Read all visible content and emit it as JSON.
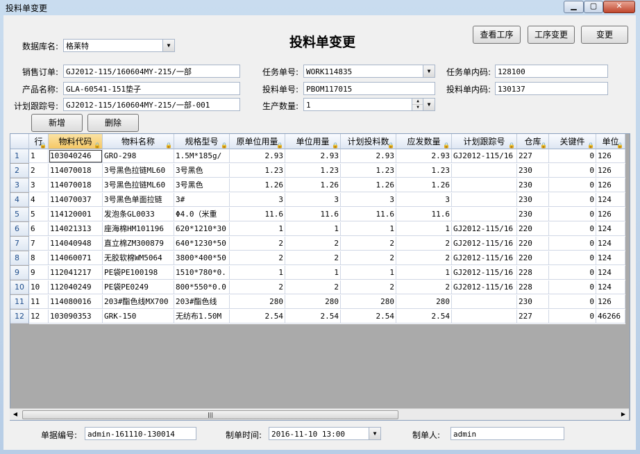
{
  "window": {
    "title": "投料单变更"
  },
  "header": {
    "page_title": "投料单变更"
  },
  "toolbar": {
    "view_process": "查看工序",
    "process_change": "工序变更",
    "change": "变更"
  },
  "form": {
    "database_label": "数据库名:",
    "database_value": "格莱特",
    "sales_order_label": "销售订单:",
    "sales_order_value": "GJ2012-115/160604MY-215/一部",
    "product_name_label": "产品名称:",
    "product_name_value": "GLA-60541-151垫子",
    "plan_track_label": "计划跟踪号:",
    "plan_track_value": "GJ2012-115/160604MY-215/一部-001",
    "task_no_label": "任务单号:",
    "task_no_value": "WORK114835",
    "feed_no_label": "投料单号:",
    "feed_no_value": "PBOM117015",
    "prod_qty_label": "生产数量:",
    "prod_qty_value": "1",
    "task_inner_label": "任务单内码:",
    "task_inner_value": "128100",
    "feed_inner_label": "投料单内码:",
    "feed_inner_value": "130137"
  },
  "actions": {
    "add": "新增",
    "delete": "删除"
  },
  "grid": {
    "columns": [
      "行",
      "物料代码",
      "物料名称",
      "规格型号",
      "原单位用量",
      "单位用量",
      "计划投料数",
      "应发数量",
      "计划跟踪号",
      "仓库",
      "关键件",
      "单位"
    ],
    "rows": [
      [
        "1",
        "1",
        "103040246",
        "GRO-298",
        "1.5M*185g/",
        "2.93",
        "2.93",
        "2.93",
        "2.93",
        "GJ2012-115/16",
        "227",
        "0",
        "126"
      ],
      [
        "2",
        "2",
        "114070018",
        "3号黑色拉链ML60",
        "3号黑色",
        "1.23",
        "1.23",
        "1.23",
        "1.23",
        "",
        "230",
        "0",
        "126"
      ],
      [
        "3",
        "3",
        "114070018",
        "3号黑色拉链ML60",
        "3号黑色",
        "1.26",
        "1.26",
        "1.26",
        "1.26",
        "",
        "230",
        "0",
        "126"
      ],
      [
        "4",
        "4",
        "114070037",
        "3号黑色单面拉链",
        "3#",
        "3",
        "3",
        "3",
        "3",
        "",
        "230",
        "0",
        "124"
      ],
      [
        "5",
        "5",
        "114120001",
        "发泡条GL0033",
        "Φ4.0（米重",
        "11.6",
        "11.6",
        "11.6",
        "11.6",
        "",
        "230",
        "0",
        "126"
      ],
      [
        "6",
        "6",
        "114021313",
        "座海棉HM101196",
        "620*1210*30",
        "1",
        "1",
        "1",
        "1",
        "GJ2012-115/16",
        "220",
        "0",
        "124"
      ],
      [
        "7",
        "7",
        "114040948",
        "直立棉ZM300879",
        "640*1230*50",
        "2",
        "2",
        "2",
        "2",
        "GJ2012-115/16",
        "220",
        "0",
        "124"
      ],
      [
        "8",
        "8",
        "114060071",
        "无胶软棉WM5064",
        "3800*400*50",
        "2",
        "2",
        "2",
        "2",
        "GJ2012-115/16",
        "220",
        "0",
        "124"
      ],
      [
        "9",
        "9",
        "112041217",
        "PE袋PE100198",
        "1510*780*0.",
        "1",
        "1",
        "1",
        "1",
        "GJ2012-115/16",
        "228",
        "0",
        "124"
      ],
      [
        "10",
        "10",
        "112040249",
        "PE袋PE0249",
        "800*550*0.0",
        "2",
        "2",
        "2",
        "2",
        "GJ2012-115/16",
        "228",
        "0",
        "124"
      ],
      [
        "11",
        "11",
        "114080016",
        "203#酯色线MX700",
        "203#酯色线",
        "280",
        "280",
        "280",
        "280",
        "",
        "230",
        "0",
        "126"
      ],
      [
        "12",
        "12",
        "103090353",
        "GRK-150",
        "无纺布1.50M",
        "2.54",
        "2.54",
        "2.54",
        "2.54",
        "",
        "227",
        "0",
        "46266"
      ]
    ]
  },
  "footer": {
    "doc_no_label": "单据编号:",
    "doc_no_value": "admin-161110-130014",
    "created_label": "制单时间:",
    "created_value": "2016-11-10 13:00",
    "creator_label": "制单人:",
    "creator_value": "admin"
  }
}
